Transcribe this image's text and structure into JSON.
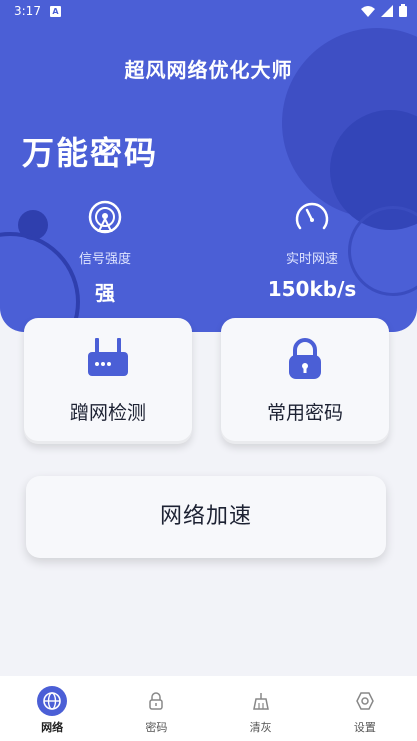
{
  "status_bar": {
    "time": "3:17",
    "notif": "A"
  },
  "header": {
    "app_title": "超风网络优化大师",
    "headline": "万能密码"
  },
  "stats": [
    {
      "label": "信号强度",
      "value": "强",
      "icon": "signal-icon"
    },
    {
      "label": "实时网速",
      "value": "150kb/s",
      "icon": "speedometer-icon"
    }
  ],
  "cards": [
    {
      "label": "蹭网检测",
      "icon": "router-icon"
    },
    {
      "label": "常用密码",
      "icon": "lock-icon"
    }
  ],
  "speed_button": {
    "label": "网络加速"
  },
  "nav": {
    "items": [
      {
        "label": "网络",
        "icon": "globe-icon",
        "active": true
      },
      {
        "label": "密码",
        "icon": "lock-icon"
      },
      {
        "label": "清灰",
        "icon": "broom-icon"
      },
      {
        "label": "设置",
        "icon": "gear-icon"
      }
    ]
  },
  "colors": {
    "primary": "#4b5fd6",
    "background": "#f2f3f8",
    "card": "#f7f8fb"
  }
}
